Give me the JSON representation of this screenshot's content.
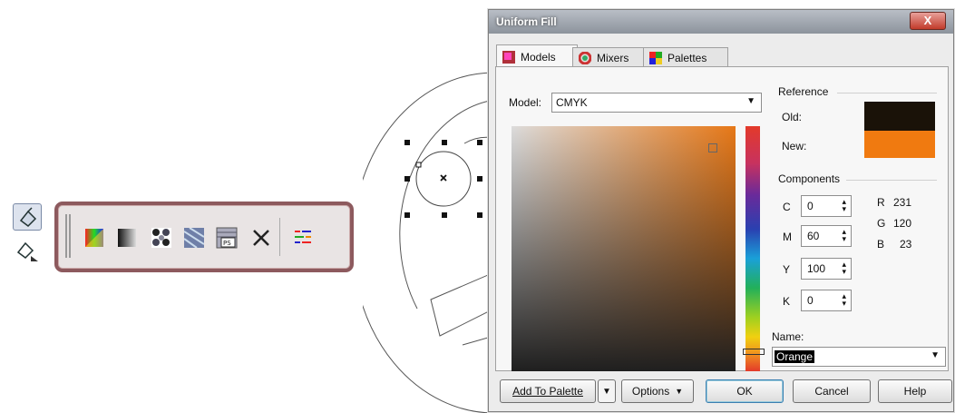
{
  "dialog": {
    "title": "Uniform Fill",
    "close_label": "X",
    "tabs": [
      {
        "label": "Models"
      },
      {
        "label": "Mixers"
      },
      {
        "label": "Palettes"
      }
    ],
    "model_label": "Model:",
    "model_value": "CMYK",
    "reference": {
      "title": "Reference",
      "old_label": "Old:",
      "new_label": "New:",
      "old_color": "#1a1208",
      "new_color": "#f07a10"
    },
    "components": {
      "title": "Components",
      "fields": [
        {
          "label": "C",
          "value": "0"
        },
        {
          "label": "M",
          "value": "60"
        },
        {
          "label": "Y",
          "value": "100"
        },
        {
          "label": "K",
          "value": "0"
        }
      ],
      "rgb": [
        {
          "label": "R",
          "value": "231"
        },
        {
          "label": "G",
          "value": "120"
        },
        {
          "label": "B",
          "value": "23"
        }
      ]
    },
    "name_label": "Name:",
    "name_value": "Orange",
    "buttons": {
      "add_to_palette": "Add To Palette",
      "options": "Options",
      "ok": "OK",
      "cancel": "Cancel",
      "help": "Help"
    }
  },
  "toolbar": {
    "icons": [
      "uniform-fill-icon",
      "fountain-fill-icon",
      "pattern-fill-icon",
      "texture-fill-icon",
      "postscript-fill-icon",
      "no-fill-icon",
      "color-docker-icon"
    ],
    "postscript_text": "PS"
  },
  "colors": {
    "flyout_border": "#8d5a5e",
    "hue_orange": "#e77817"
  }
}
